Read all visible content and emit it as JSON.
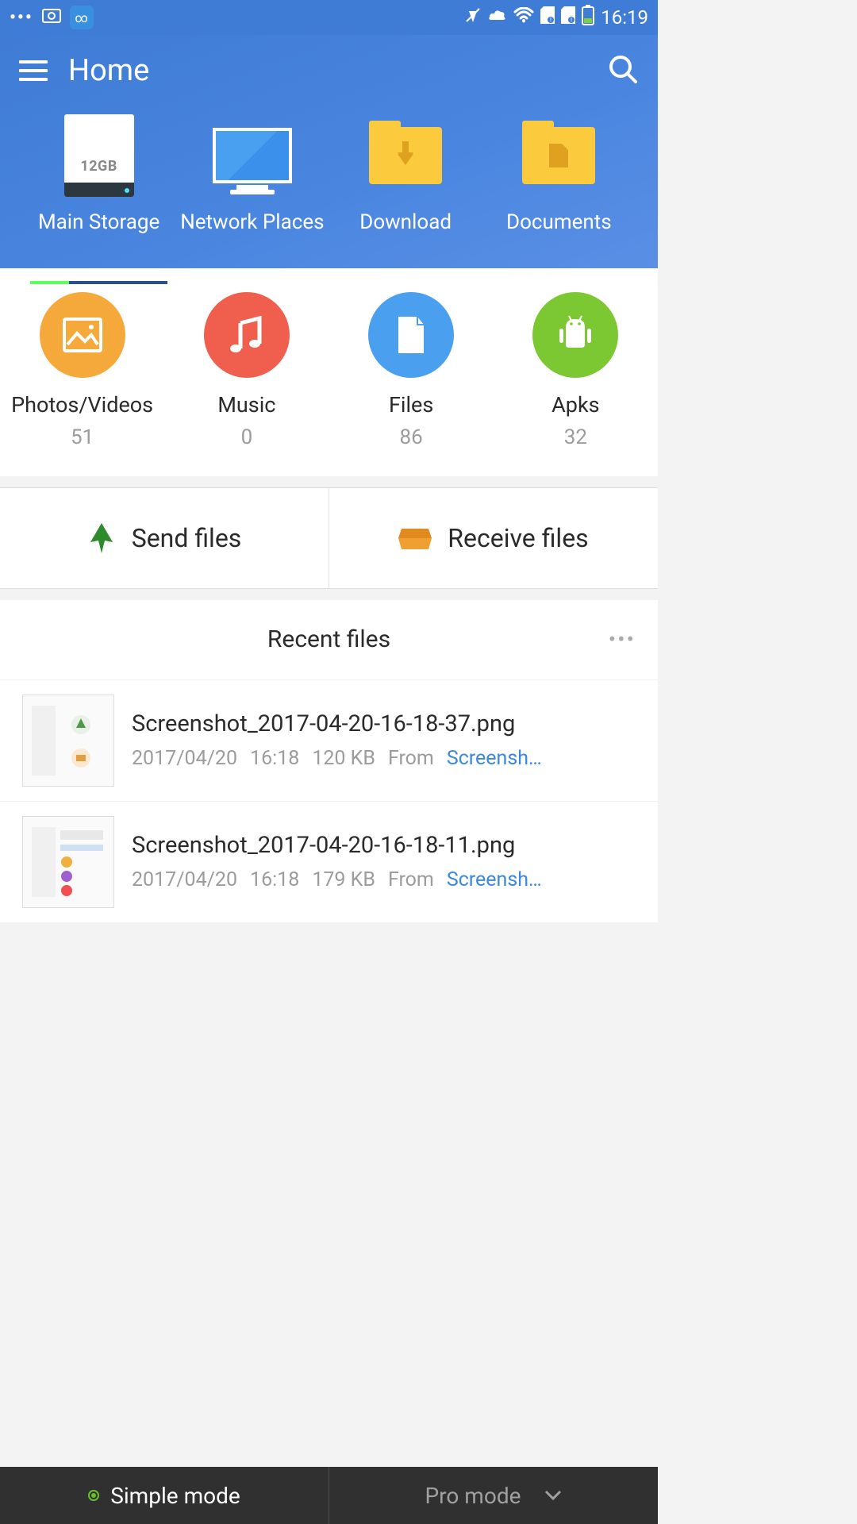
{
  "status": {
    "time": "16:19"
  },
  "header": {
    "title": "Home"
  },
  "storage": {
    "items": [
      {
        "label": "Main Storage",
        "badge": "12GB"
      },
      {
        "label": "Network Places"
      },
      {
        "label": "Download"
      },
      {
        "label": "Documents"
      }
    ]
  },
  "categories": [
    {
      "label": "Photos/Videos",
      "count": "51"
    },
    {
      "label": "Music",
      "count": "0"
    },
    {
      "label": "Files",
      "count": "86"
    },
    {
      "label": "Apks",
      "count": "32"
    }
  ],
  "transfer": {
    "send": "Send files",
    "receive": "Receive files"
  },
  "recent": {
    "title": "Recent files",
    "files": [
      {
        "name": "Screenshot_2017-04-20-16-18-37.png",
        "date": "2017/04/20",
        "time": "16:18",
        "size": "120 KB",
        "from": "From",
        "source": "Screensh…"
      },
      {
        "name": "Screenshot_2017-04-20-16-18-11.png",
        "date": "2017/04/20",
        "time": "16:18",
        "size": "179 KB",
        "from": "From",
        "source": "Screensh…"
      }
    ]
  },
  "bottom": {
    "simple": "Simple mode",
    "pro": "Pro mode"
  }
}
